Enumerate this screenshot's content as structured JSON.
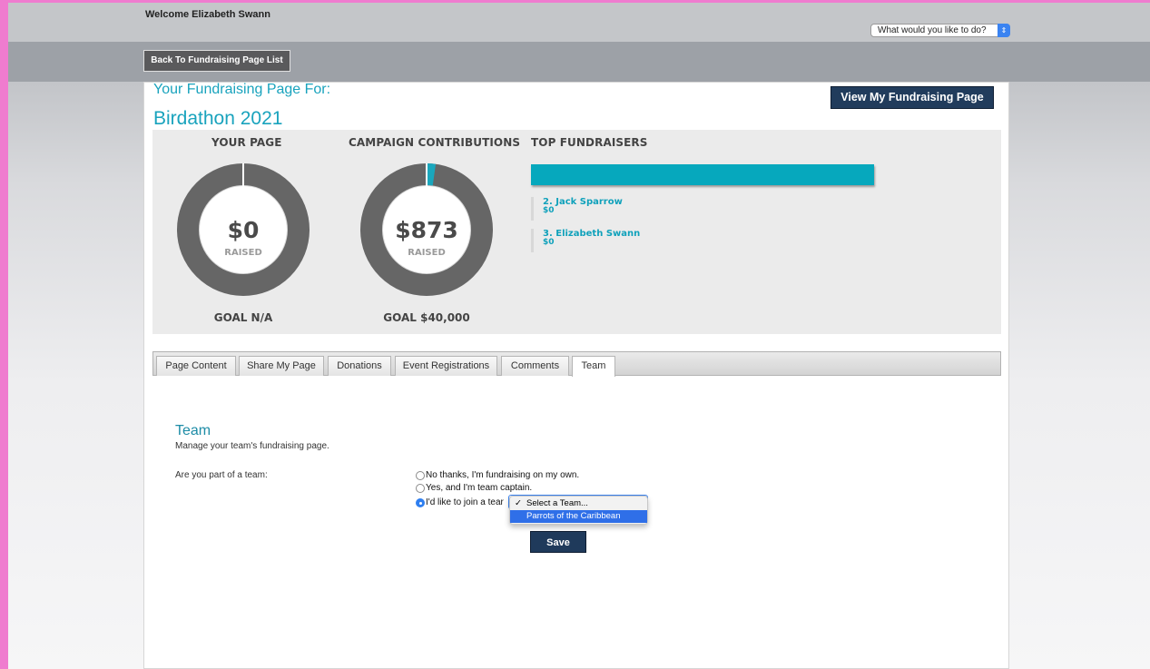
{
  "header": {
    "welcome": "Welcome Elizabeth Swann",
    "action_select": "What would you like to do?"
  },
  "nav": {
    "back_button": "Back To Fundraising Page List"
  },
  "page": {
    "heading": "Your Fundraising Page For:",
    "campaign_name": "Birdathon 2021",
    "view_button": "View My Fundraising Page"
  },
  "stats": {
    "your_page": {
      "title": "YOUR PAGE",
      "amount": "$0",
      "raised_label": "RAISED",
      "goal": "GOAL N/A",
      "progress": 0
    },
    "campaign": {
      "title": "CAMPAIGN CONTRIBUTIONS",
      "amount": "$873",
      "raised_label": "RAISED",
      "goal": "GOAL $40,000",
      "progress": 0.022
    },
    "top_fundraisers": {
      "title": "TOP FUNDRAISERS",
      "leader_bar_fraction": 1.0,
      "items": [
        {
          "name": "2. Jack Sparrow",
          "amount": "$0"
        },
        {
          "name": "3. Elizabeth Swann",
          "amount": "$0"
        }
      ]
    }
  },
  "tabs": [
    "Page Content",
    "Share My Page",
    "Donations",
    "Event Registrations",
    "Comments",
    "Team"
  ],
  "active_tab": "Team",
  "team": {
    "title": "Team",
    "subtitle": "Manage your team's fundraising page.",
    "question": "Are you part of a team:",
    "options": [
      {
        "label": "No thanks, I'm fundraising on my own.",
        "checked": false
      },
      {
        "label": "Yes, and I'm team captain.",
        "checked": false
      },
      {
        "label": "I'd like to join a tear",
        "checked": true
      }
    ],
    "team_select": {
      "options": [
        "Select a Team...",
        "Parrots of the Caribbean"
      ],
      "selected": "Select a Team...",
      "highlighted": "Parrots of the Caribbean",
      "check_glyph": "✓"
    },
    "save_button": "Save"
  },
  "colors": {
    "accent": "#19a3bd",
    "button_dark": "#213c5c",
    "donut_gray": "#666666",
    "bar_teal": "#06a8bd",
    "page_border_pink": "#ef7ccf"
  }
}
